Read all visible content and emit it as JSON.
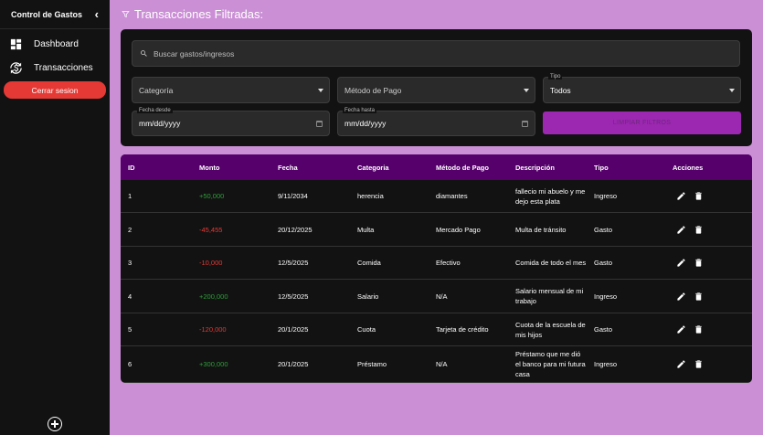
{
  "sidebar": {
    "title": "Control de Gastos",
    "items": [
      {
        "label": "Dashboard"
      },
      {
        "label": "Transacciones"
      }
    ],
    "logout_label": "Cerrar sesion"
  },
  "heading": "Transacciones Filtradas:",
  "filters": {
    "search_placeholder": "Buscar gastos/ingresos",
    "category_placeholder": "Categoría",
    "method_placeholder": "Método de Pago",
    "type_label": "Tipo",
    "type_value": "Todos",
    "date_from_label": "Fecha desde",
    "date_from_value": "mm/dd/yyyy",
    "date_to_label": "Fecha hasta",
    "date_to_value": "mm/dd/yyyy",
    "clear_label": "LIMPIAR FILTROS"
  },
  "table": {
    "headers": [
      "ID",
      "Monto",
      "Fecha",
      "Categoria",
      "Método de Pago",
      "Descripción",
      "Tipo",
      "Acciones"
    ],
    "rows": [
      {
        "id": "1",
        "amount": "+50,000",
        "date": "9/11/2034",
        "category": "herencia",
        "method": "diamantes",
        "description": "fallecio mi abuelo y me dejo esta plata",
        "type": "Ingreso"
      },
      {
        "id": "2",
        "amount": "-45,455",
        "date": "20/12/2025",
        "category": "Multa",
        "method": "Mercado Pago",
        "description": "Multa de tránsito",
        "type": "Gasto"
      },
      {
        "id": "3",
        "amount": "-10,000",
        "date": "12/5/2025",
        "category": "Comida",
        "method": "Efectivo",
        "description": "Comida de todo el mes",
        "type": "Gasto"
      },
      {
        "id": "4",
        "amount": "+200,000",
        "date": "12/5/2025",
        "category": "Salario",
        "method": "N/A",
        "description": "Salario mensual de mi trabajo",
        "type": "Ingreso"
      },
      {
        "id": "5",
        "amount": "-120,000",
        "date": "20/1/2025",
        "category": "Cuota",
        "method": "Tarjeta de crédito",
        "description": "Cuota de la escuela de mis hijos",
        "type": "Gasto"
      },
      {
        "id": "6",
        "amount": "+300,000",
        "date": "20/1/2025",
        "category": "Préstamo",
        "method": "N/A",
        "description": "Préstamo que me dió el banco para mi futura casa",
        "type": "Ingreso"
      }
    ]
  },
  "colors": {
    "background": "#cb8fd6",
    "panel": "#121212",
    "header_purple": "#55006b",
    "accent": "#9c27b0",
    "logout": "#e53935",
    "positive": "#2e9e3a",
    "negative": "#e53935"
  }
}
